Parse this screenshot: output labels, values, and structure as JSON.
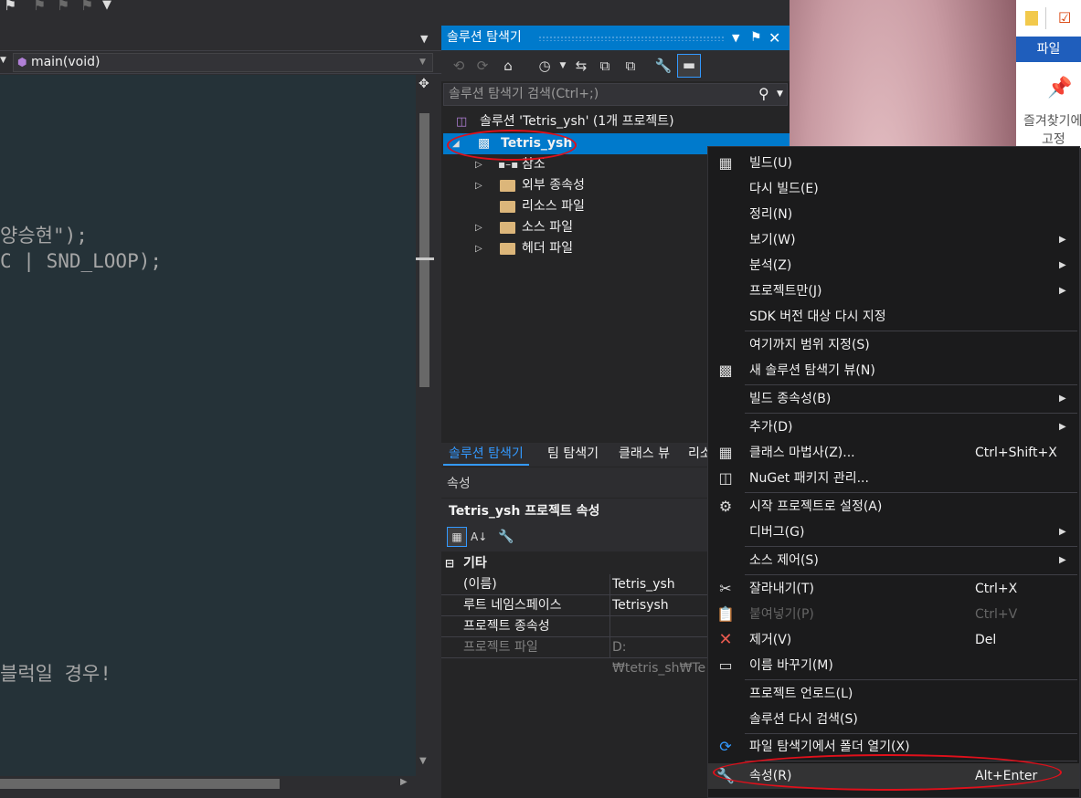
{
  "editor": {
    "navbar_function": "main(void)",
    "code_lines": [
      "양승현\");",
      "C | SND_LOOP);",
      "블럭일 경우!"
    ]
  },
  "solution_explorer": {
    "title": "솔루션 탐색기",
    "search_placeholder": "솔루션 탐색기 검색(Ctrl+;)",
    "solution_label": "솔루션 'Tetris_ysh' (1개 프로젝트)",
    "project_label": "Tetris_ysh",
    "nodes": [
      "참조",
      "외부 종속성",
      "리소스 파일",
      "소스 파일",
      "헤더 파일"
    ],
    "tabs": [
      "솔루션 탐색기",
      "팀 탐색기",
      "클래스 뷰",
      "리소"
    ]
  },
  "properties": {
    "title": "속성",
    "object_label": "Tetris_ysh 프로젝트 속성",
    "category": "기타",
    "rows": [
      {
        "name": "(이름)",
        "value": "Tetris_ysh"
      },
      {
        "name": "루트 네임스페이스",
        "value": "Tetrisysh"
      },
      {
        "name": "프로젝트 종속성",
        "value": ""
      },
      {
        "name": "프로젝트 파일",
        "value": "D:₩tetris_sh₩Te"
      }
    ]
  },
  "file_explorer": {
    "file_tab": "파일",
    "pin_label_1": "즐겨찾기에",
    "pin_label_2": "고정"
  },
  "context_menu": {
    "items": [
      {
        "label": "빌드(U)"
      },
      {
        "label": "다시 빌드(E)"
      },
      {
        "label": "정리(N)"
      },
      {
        "label": "보기(W)"
      },
      {
        "label": "분석(Z)"
      },
      {
        "label": "프로젝트만(J)"
      },
      {
        "label": "SDK 버전 대상 다시 지정"
      },
      {
        "label": "여기까지 범위 지정(S)"
      },
      {
        "label": "새 솔루션 탐색기 뷰(N)"
      },
      {
        "label": "빌드 종속성(B)"
      },
      {
        "label": "추가(D)"
      },
      {
        "label": "클래스 마법사(Z)...",
        "shortcut": "Ctrl+Shift+X"
      },
      {
        "label": "NuGet 패키지 관리..."
      },
      {
        "label": "시작 프로젝트로 설정(A)"
      },
      {
        "label": "디버그(G)"
      },
      {
        "label": "소스 제어(S)"
      },
      {
        "label": "잘라내기(T)",
        "shortcut": "Ctrl+X"
      },
      {
        "label": "붙여넣기(P)",
        "shortcut": "Ctrl+V"
      },
      {
        "label": "제거(V)",
        "shortcut": "Del"
      },
      {
        "label": "이름 바꾸기(M)"
      },
      {
        "label": "프로젝트 언로드(L)"
      },
      {
        "label": "솔루션 다시 검색(S)"
      },
      {
        "label": "파일 탐색기에서 폴더 열기(X)"
      },
      {
        "label": "속성(R)",
        "shortcut": "Alt+Enter"
      }
    ]
  }
}
